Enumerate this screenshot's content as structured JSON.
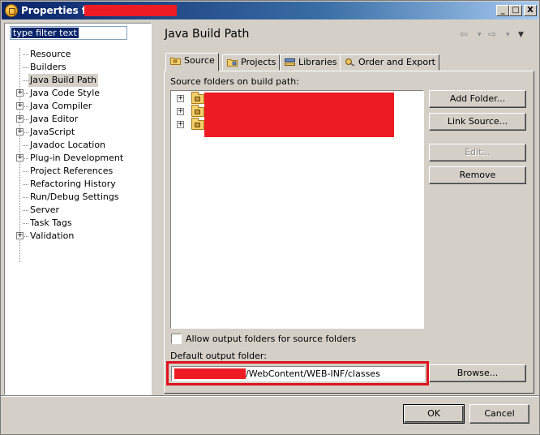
{
  "window": {
    "title": "Properties for",
    "controls": [
      "_",
      "□",
      "X"
    ]
  },
  "sidebar": {
    "filter_value": "type filter text",
    "items": [
      {
        "label": "Resource",
        "expandable": false
      },
      {
        "label": "Builders",
        "expandable": false
      },
      {
        "label": "Java Build Path",
        "expandable": false,
        "selected": true
      },
      {
        "label": "Java Code Style",
        "expandable": true
      },
      {
        "label": "Java Compiler",
        "expandable": true
      },
      {
        "label": "Java Editor",
        "expandable": true
      },
      {
        "label": "JavaScript",
        "expandable": true
      },
      {
        "label": "Javadoc Location",
        "expandable": false
      },
      {
        "label": "Plug-in Development",
        "expandable": true
      },
      {
        "label": "Project References",
        "expandable": false
      },
      {
        "label": "Refactoring History",
        "expandable": false
      },
      {
        "label": "Run/Debug Settings",
        "expandable": false
      },
      {
        "label": "Server",
        "expandable": false
      },
      {
        "label": "Task Tags",
        "expandable": false
      },
      {
        "label": "Validation",
        "expandable": true
      }
    ]
  },
  "page": {
    "title": "Java Build Path",
    "nav": {
      "back": "⇦",
      "forward": "⇨",
      "menu": "▼",
      "dropdown": "▾"
    }
  },
  "tabs": [
    {
      "label": "Source",
      "active": true,
      "icon": "source-folder-icon"
    },
    {
      "label": "Projects",
      "active": false,
      "icon": "projects-icon"
    },
    {
      "label": "Libraries",
      "active": false,
      "icon": "libraries-icon"
    },
    {
      "label": "Order and Export",
      "active": false,
      "icon": "order-export-icon"
    }
  ],
  "source": {
    "folders_label": "Source folders on build path:",
    "buttons": {
      "add_folder": "Add Folder...",
      "link_source": "Link Source...",
      "edit": "Edit...",
      "remove": "Remove"
    },
    "allow_output_label": "Allow output folders for source folders",
    "allow_output_checked": false,
    "default_output_label": "Default output folder:",
    "default_output_value": "/WebContent/WEB-INF/classes",
    "browse": "Browse..."
  },
  "footer": {
    "ok": "OK",
    "cancel": "Cancel"
  },
  "colors": {
    "redaction": "#ed1c24",
    "highlight_border": "#e0121e",
    "titlebar_start": "#0a246a",
    "dialog_bg": "#d4d0c8"
  }
}
